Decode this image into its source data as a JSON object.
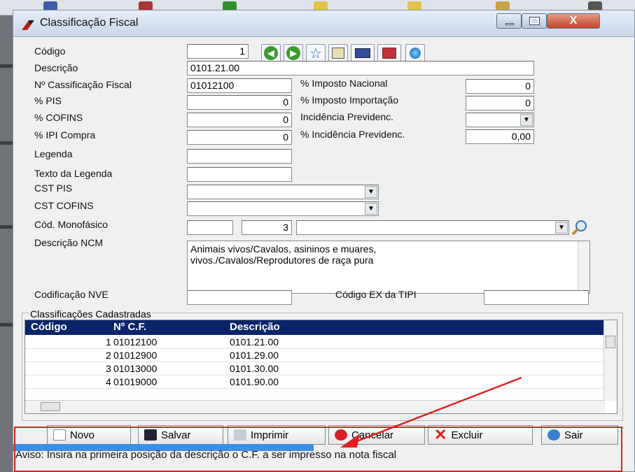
{
  "window": {
    "title": "Classificação Fiscal",
    "close_glyph": "X"
  },
  "form": {
    "codigo": {
      "label": "Código",
      "value": "1"
    },
    "descricao": {
      "label": "Descrição",
      "value": "0101.21.00"
    },
    "ncf": {
      "label": "Nº Cassificação Fiscal",
      "value": "01012100"
    },
    "pis": {
      "label": "% PIS",
      "value": "0"
    },
    "cofins": {
      "label": "% COFINS",
      "value": "0"
    },
    "ipi": {
      "label": "% IPI Compra",
      "value": "0"
    },
    "legenda": {
      "label": "Legenda",
      "value": ""
    },
    "texto_legenda": {
      "label": "Texto da Legenda",
      "value": ""
    },
    "cst_pis": {
      "label": "CST PIS",
      "value": ""
    },
    "cst_cofins": {
      "label": "CST COFINS",
      "value": ""
    },
    "cod_mono": {
      "label": "Cód. Monofásico",
      "value1": "",
      "value2": "3",
      "value3": ""
    },
    "desc_ncm": {
      "label": "Descrição NCM",
      "value": "Animais vivos/Cavalos, asininos e muares,\nvivos./Cavalos/Reprodutores de raça pura"
    },
    "nve": {
      "label": "Codificação NVE",
      "value": ""
    },
    "ex_tipi": {
      "label": "Código EX da TIPI",
      "value": ""
    },
    "imp_nacional": {
      "label": "% Imposto Nacional",
      "value": "0"
    },
    "imp_importacao": {
      "label": "% Imposto Importação",
      "value": "0"
    },
    "incid_prev": {
      "label": "Incidência Previdenc.",
      "value": ""
    },
    "pct_incid_prev": {
      "label": "% Incidência Previdenc.",
      "value": "0,00"
    }
  },
  "grid": {
    "group_label": "Classificações Cadastradas",
    "columns": [
      "Código",
      "Nº C.F.",
      "Descrição"
    ],
    "rows": [
      {
        "codigo": "1",
        "ncf": "01012100",
        "descricao": "0101.21.00"
      },
      {
        "codigo": "2",
        "ncf": "01012900",
        "descricao": "0101.29.00"
      },
      {
        "codigo": "3",
        "ncf": "01013000",
        "descricao": "0101.30.00"
      },
      {
        "codigo": "4",
        "ncf": "01019000",
        "descricao": "0101.90.00"
      }
    ]
  },
  "buttons": {
    "novo": "Novo",
    "salvar": "Salvar",
    "imprimir": "Imprimir",
    "cancelar": "Cancelar",
    "excluir": "Excluir",
    "sair": "Sair"
  },
  "status": {
    "aviso": "Aviso: Insira na primeira posição da descrição o C.F. a ser impresso na nota fiscal",
    "progress": 0.5
  },
  "colors": {
    "accent": "#0a246a",
    "annotation": "#e02020",
    "progress": "#3d8fe3"
  },
  "icons": [
    "first-record-icon",
    "next-record-icon",
    "star-icon",
    "notes-icon",
    "search-window-icon",
    "refresh-icon",
    "globe-icon",
    "magnifier-icon",
    "new-document-icon",
    "save-icon",
    "print-icon",
    "cancel-icon",
    "delete-icon",
    "exit-icon"
  ]
}
